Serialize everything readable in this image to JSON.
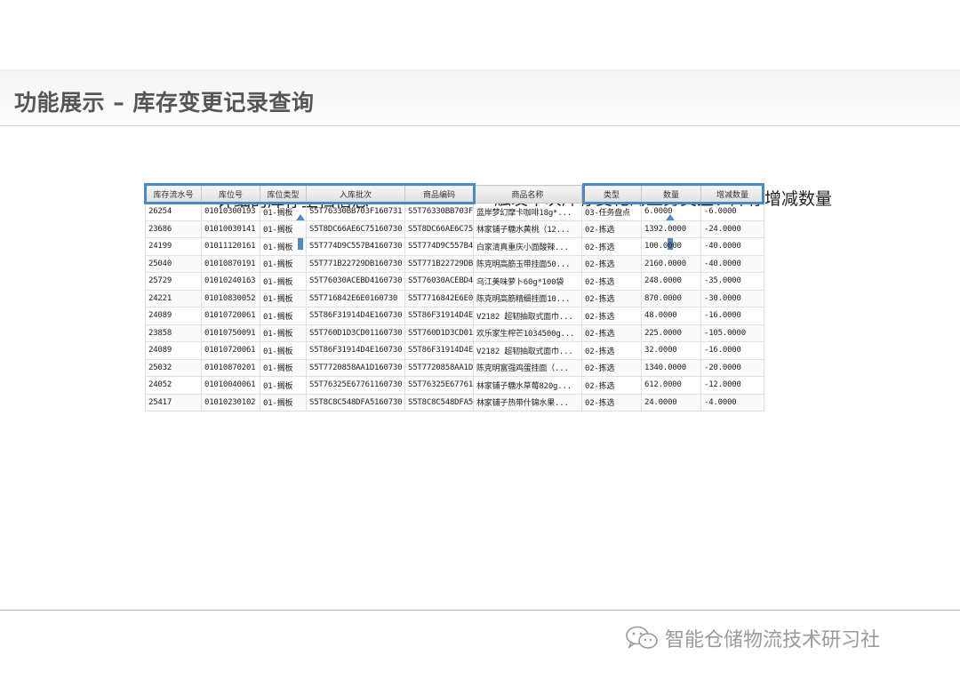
{
  "slide": {
    "title": "功能展示 – 库存变更记录查询"
  },
  "callouts": {
    "left": "详细的库存主档信息",
    "right": "触发本次库存变化的业务类型、库存增减数量"
  },
  "table": {
    "columns": [
      "库存流水号",
      "库位号",
      "库位类型",
      "入库批次",
      "商品编码",
      "商品名称",
      "类型",
      "数量",
      "增减数量"
    ],
    "rows": [
      [
        "26254",
        "01010300193",
        "01-搁板",
        "S5T76330BB703F160731",
        "S5T76330BB703F",
        "蓝岸梦幻摩卡咖啡18g*...",
        "03-任务盘点",
        "6.0000",
        "-6.0000"
      ],
      [
        "23686",
        "01010030141",
        "01-搁板",
        "S5T8DC66AE6C75160730",
        "S5T8DC66AE6C75",
        "林家铺子糖水黄桃（12...",
        "02-拣选",
        "1392.0000",
        "-24.0000"
      ],
      [
        "24199",
        "01011120161",
        "01-搁板",
        "S5T774D9C557B4160730",
        "S5T774D9C557B4",
        "白家清真重庆小面酸辣...",
        "02-拣选",
        "100.0000",
        "-40.0000"
      ],
      [
        "25040",
        "01010870191",
        "01-搁板",
        "S5T771B22729DB160730",
        "S5T771B22729DB",
        "陈克明高筋玉带挂面50...",
        "02-拣选",
        "2160.0000",
        "-40.0000"
      ],
      [
        "25729",
        "01010240163",
        "01-搁板",
        "S5T76030ACEBD4160730",
        "S5T76030ACEBD4",
        "乌江美味萝卜60g*100袋",
        "02-拣选",
        "248.0000",
        "-35.0000"
      ],
      [
        "24221",
        "01010830052",
        "01-搁板",
        "S5T716842E6E0160730",
        "S5T7716842E6E0",
        "陈克明高筋精细挂面10...",
        "02-拣选",
        "870.0000",
        "-30.0000"
      ],
      [
        "24089",
        "01010720061",
        "01-搁板",
        "S5T86F31914D4E160730",
        "S5T86F31914D4E",
        "V2182 超韧抽取式面巾...",
        "02-拣选",
        "48.0000",
        "-16.0000"
      ],
      [
        "23858",
        "01010750091",
        "01-搁板",
        "S5T760D1D3CD01160730",
        "S5T760D1D3CD01",
        "欢乐家生榨芒1034500g...",
        "02-拣选",
        "225.0000",
        "-105.0000"
      ],
      [
        "24089",
        "01010720061",
        "01-搁板",
        "S5T86F31914D4E160730",
        "S5T86F31914D4E",
        "V2182 超韧抽取式面巾...",
        "02-拣选",
        "32.0000",
        "-16.0000"
      ],
      [
        "25032",
        "01010870201",
        "01-搁板",
        "S5T7720858AA1D160730",
        "S5T7720858AA1D",
        "陈克明富强鸡蛋挂面（...",
        "02-拣选",
        "1340.0000",
        "-20.0000"
      ],
      [
        "24052",
        "01010040061",
        "01-搁板",
        "S5T76325E67761160730",
        "S5T76325E67761",
        "林家铺子糖水草莓820g...",
        "02-拣选",
        "612.0000",
        "-12.0000"
      ],
      [
        "25417",
        "01010230102",
        "01-搁板",
        "S5T8C8C548DFA5160730",
        "S5T8C8C548DFA5",
        "林家铺子热带什锦水果...",
        "02-拣选",
        "24.0000",
        "-4.0000"
      ]
    ]
  },
  "footer": {
    "brand": "智能仓储物流技术研习社",
    "icon": "wechat-icon"
  },
  "colors": {
    "highlight": "#4a8bc4",
    "arrow": "#4a8bc4",
    "title": "#555555"
  }
}
